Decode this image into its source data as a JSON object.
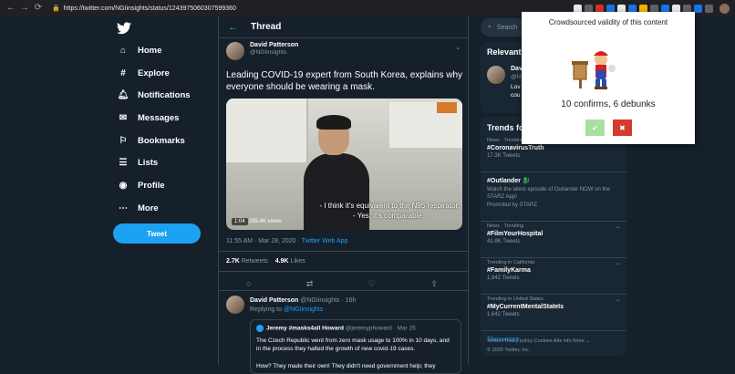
{
  "browser": {
    "url": "https://twitter.com/NGIinsights/status/1243975060307599360",
    "back_icon": "arrow-left-icon",
    "forward_icon": "arrow-right-icon",
    "reload_icon": "reload-icon"
  },
  "leftnav": {
    "items": [
      {
        "label": "Home",
        "icon": "home-icon"
      },
      {
        "label": "Explore",
        "icon": "hash-icon"
      },
      {
        "label": "Notifications",
        "icon": "bell-icon"
      },
      {
        "label": "Messages",
        "icon": "mail-icon"
      },
      {
        "label": "Bookmarks",
        "icon": "bookmark-icon"
      },
      {
        "label": "Lists",
        "icon": "list-icon"
      },
      {
        "label": "Profile",
        "icon": "profile-icon"
      },
      {
        "label": "More",
        "icon": "more-icon"
      }
    ],
    "tweet_button": "Tweet"
  },
  "thread": {
    "header": "Thread",
    "author_name": "David Patterson",
    "author_handle": "@NGIinsights",
    "text": "Leading COVID-19 expert from South Korea, explains why everyone should be wearing a mask.",
    "subtitle_1": "- I think it's equivalent to the N95 respirator.",
    "subtitle_2": "- Yes, it's comparable.",
    "video_time": "1:04",
    "video_views": "285.4K views",
    "time": "11:55 AM · Mar 28, 2020 · ",
    "source": "Twitter Web App",
    "retweets": "2.7K",
    "retweets_label": " Retweets",
    "likes": "4.9K",
    "likes_label": " Likes"
  },
  "reply": {
    "author_name": "David Patterson",
    "author_handle": "@NGIinsights · 16h",
    "replying_prefix": "Replying to ",
    "replying_to": "@NGIinsights",
    "quote_author": "Jeremy #masks4all Howard",
    "quote_handle": "@jeremyphoward · Mar 25",
    "quote_text": "The Czech Republic went from zero mask usage to 100% in 10 days, and in the process they halted the growth of new covid-19 cases.",
    "quote_text_2": "How? They made their own! They didn't need government help; they"
  },
  "sidebar": {
    "search_placeholder": "Search",
    "relevant_header": "Relevant",
    "relevant_name": "Davi",
    "relevant_handle": "@N",
    "relevant_bio_1": "Lov",
    "relevant_bio_2": "cou",
    "trends_header": "Trends fo",
    "trends": [
      {
        "context": "News · Trending",
        "name": "#CoronavirusTruth",
        "sub": "17.3K Tweets"
      },
      {
        "context": "",
        "name": "#Outlander 🐉",
        "desc": "Watch the latest episode of Outlander NOW on the STARZ App!",
        "sub": "Promoted by STARZ"
      },
      {
        "context": "News · Trending",
        "name": "#FilmYourHospital",
        "sub": "41.8K Tweets"
      },
      {
        "context": "Trending in California",
        "name": "#FamilyKarma",
        "sub": "1,942 Tweets"
      },
      {
        "context": "Trending in United States",
        "name": "#MyCurrentMentalStateIs",
        "sub": "1,642 Tweets"
      }
    ],
    "show_more": "Show more",
    "footer_line_1": "Terms   Privacy policy   Cookies   Ads info   More ⌄",
    "footer_line_2": "© 2020 Twitter, Inc."
  },
  "popup": {
    "title": "Crowdsourced validity of this content",
    "result": "10 confirms, 6 debunks",
    "confirm_symbol": "✔",
    "debunk_symbol": "✖",
    "confirm_color": "#a8e0a0",
    "debunk_color": "#d43b2a"
  },
  "colors": {
    "background": "#15202b",
    "accent": "#1da1f2"
  }
}
